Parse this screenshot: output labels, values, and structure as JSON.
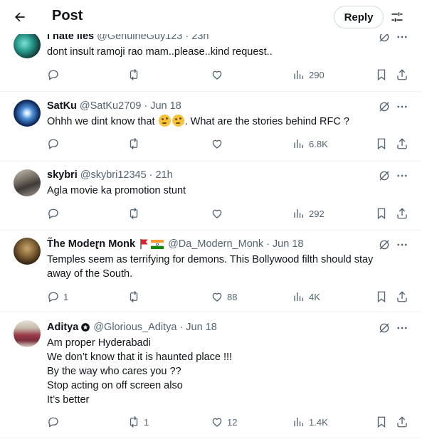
{
  "header": {
    "title": "Post",
    "reply_label": "Reply",
    "back_icon": "arrow-left-icon",
    "filter_icon": "sliders-icon"
  },
  "posts": [
    {
      "name": "I hate lies",
      "handle": "@GenuineGuy123",
      "time": "23h",
      "lines": [
        "dont insult ramoji rao mam..please..kind request.."
      ],
      "replies": "",
      "reposts": "",
      "likes": "",
      "views": "290"
    },
    {
      "name": "SatKu",
      "handle": "@SatKu2709",
      "time": "Jun 18",
      "text_before": "Ohhh we dint know that",
      "emoji": "thinking-face",
      "text_after": ". What are the stories behind RFC ?",
      "replies": "",
      "reposts": "",
      "likes": "",
      "views": "6.8K"
    },
    {
      "name": "skybri",
      "handle": "@skybri12345",
      "time": "21h",
      "lines": [
        "Agla movie ka promotion stunt"
      ],
      "replies": "",
      "reposts": "",
      "likes": "",
      "views": "292"
    },
    {
      "name": "T̃he Modeɽn Monk",
      "handle": "@Da_Modern_Monk",
      "time": "Jun 18",
      "lines": [
        "Temples seem as terrifying for demons. This Bollywood filth should stay",
        "away of the South."
      ],
      "replies": "1",
      "reposts": "",
      "likes": "88",
      "views": "4K"
    },
    {
      "name": "Aditya",
      "handle": "@Glorious_Aditya",
      "time": "Jun 18",
      "lines": [
        "Am proper Hyderabadi",
        "We don’t know that it is haunted place !!!",
        "By the way who cares you ??",
        "Stop acting  on off screen also",
        "It’s better"
      ],
      "replies": "",
      "reposts": "1",
      "likes": "12",
      "views": "1.4K"
    }
  ],
  "colors": {
    "text": "#0f1419",
    "secondary": "#536471",
    "divider": "#eff3f4",
    "flag_red": "#e0242b",
    "india_saffron": "#ff9933",
    "india_green": "#138808"
  }
}
